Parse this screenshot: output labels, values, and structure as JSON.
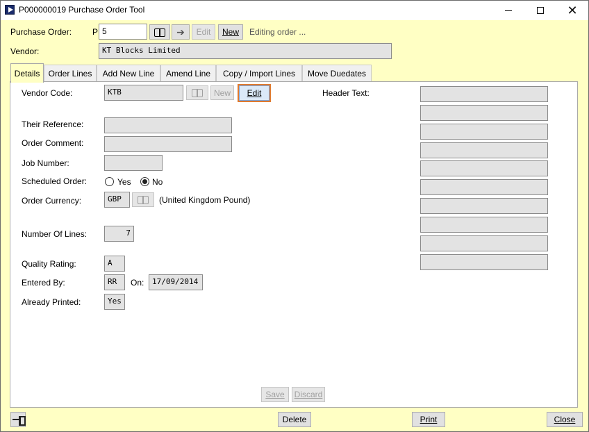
{
  "window": {
    "title": "P000000019 Purchase Order Tool"
  },
  "header": {
    "po_label": "Purchase Order:",
    "po_prefix": "P",
    "po_value": "5",
    "edit_label": "Edit",
    "new_label": "New",
    "status": "Editing order ...",
    "vendor_label": "Vendor:",
    "vendor_value": "KT Blocks Limited"
  },
  "tabs": [
    {
      "label": "Details",
      "active": true
    },
    {
      "label": "Order Lines"
    },
    {
      "label": "Add New Line"
    },
    {
      "label": "Amend Line"
    },
    {
      "label": "Copy / Import Lines"
    },
    {
      "label": "Move Duedates"
    }
  ],
  "details": {
    "vendor_code_label": "Vendor Code:",
    "vendor_code": "KTB",
    "new_label": "New",
    "edit_label": "Edit",
    "header_text_label": "Header Text:",
    "their_reference_label": "Their Reference:",
    "their_reference": "",
    "order_comment_label": "Order Comment:",
    "order_comment": "",
    "job_number_label": "Job Number:",
    "job_number": "",
    "scheduled_order_label": "Scheduled Order:",
    "yes_label": "Yes",
    "no_label": "No",
    "scheduled_selected": "No",
    "order_currency_label": "Order Currency:",
    "currency_code": "GBP",
    "currency_name": "(United Kingdom Pound)",
    "number_of_lines_label": "Number Of Lines:",
    "number_of_lines": "7",
    "quality_rating_label": "Quality Rating:",
    "quality_rating": "A",
    "entered_by_label": "Entered By:",
    "entered_by": "RR",
    "on_label": "On:",
    "entered_on": "17/09/2014",
    "already_printed_label": "Already Printed:",
    "already_printed": "Yes",
    "save_label": "Save",
    "discard_label": "Discard",
    "header_text_lines": [
      "",
      "",
      "",
      "",
      "",
      "",
      "",
      "",
      "",
      ""
    ]
  },
  "footer": {
    "delete_label": "Delete",
    "print_label": "Print",
    "close_label": "Close"
  },
  "icons": {
    "book": "book-icon",
    "arrow": "arrow-right-icon",
    "pin": "pin-icon"
  },
  "colors": {
    "window_bg": "#ffffc4",
    "focus_ring": "#e07a2e"
  }
}
